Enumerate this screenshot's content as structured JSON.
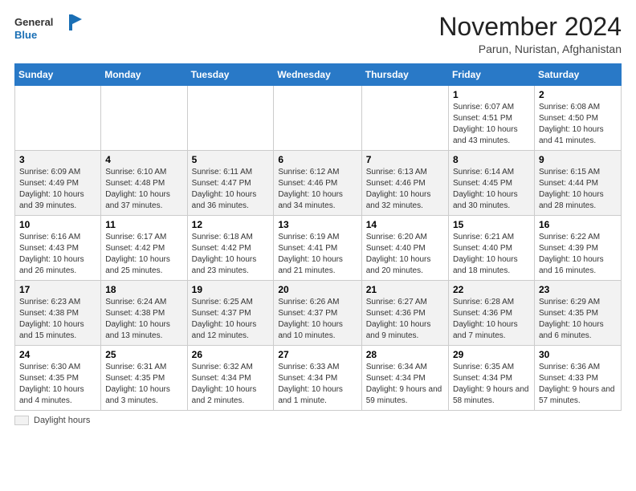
{
  "header": {
    "logo_line1": "General",
    "logo_line2": "Blue",
    "month_title": "November 2024",
    "location": "Parun, Nuristan, Afghanistan"
  },
  "days_of_week": [
    "Sunday",
    "Monday",
    "Tuesday",
    "Wednesday",
    "Thursday",
    "Friday",
    "Saturday"
  ],
  "footer": {
    "daylight_label": "Daylight hours"
  },
  "weeks": [
    [
      {
        "day": "",
        "sunrise": "",
        "sunset": "",
        "daylight": ""
      },
      {
        "day": "",
        "sunrise": "",
        "sunset": "",
        "daylight": ""
      },
      {
        "day": "",
        "sunrise": "",
        "sunset": "",
        "daylight": ""
      },
      {
        "day": "",
        "sunrise": "",
        "sunset": "",
        "daylight": ""
      },
      {
        "day": "",
        "sunrise": "",
        "sunset": "",
        "daylight": ""
      },
      {
        "day": "1",
        "sunrise": "6:07 AM",
        "sunset": "4:51 PM",
        "daylight": "10 hours and 43 minutes."
      },
      {
        "day": "2",
        "sunrise": "6:08 AM",
        "sunset": "4:50 PM",
        "daylight": "10 hours and 41 minutes."
      }
    ],
    [
      {
        "day": "3",
        "sunrise": "6:09 AM",
        "sunset": "4:49 PM",
        "daylight": "10 hours and 39 minutes."
      },
      {
        "day": "4",
        "sunrise": "6:10 AM",
        "sunset": "4:48 PM",
        "daylight": "10 hours and 37 minutes."
      },
      {
        "day": "5",
        "sunrise": "6:11 AM",
        "sunset": "4:47 PM",
        "daylight": "10 hours and 36 minutes."
      },
      {
        "day": "6",
        "sunrise": "6:12 AM",
        "sunset": "4:46 PM",
        "daylight": "10 hours and 34 minutes."
      },
      {
        "day": "7",
        "sunrise": "6:13 AM",
        "sunset": "4:46 PM",
        "daylight": "10 hours and 32 minutes."
      },
      {
        "day": "8",
        "sunrise": "6:14 AM",
        "sunset": "4:45 PM",
        "daylight": "10 hours and 30 minutes."
      },
      {
        "day": "9",
        "sunrise": "6:15 AM",
        "sunset": "4:44 PM",
        "daylight": "10 hours and 28 minutes."
      }
    ],
    [
      {
        "day": "10",
        "sunrise": "6:16 AM",
        "sunset": "4:43 PM",
        "daylight": "10 hours and 26 minutes."
      },
      {
        "day": "11",
        "sunrise": "6:17 AM",
        "sunset": "4:42 PM",
        "daylight": "10 hours and 25 minutes."
      },
      {
        "day": "12",
        "sunrise": "6:18 AM",
        "sunset": "4:42 PM",
        "daylight": "10 hours and 23 minutes."
      },
      {
        "day": "13",
        "sunrise": "6:19 AM",
        "sunset": "4:41 PM",
        "daylight": "10 hours and 21 minutes."
      },
      {
        "day": "14",
        "sunrise": "6:20 AM",
        "sunset": "4:40 PM",
        "daylight": "10 hours and 20 minutes."
      },
      {
        "day": "15",
        "sunrise": "6:21 AM",
        "sunset": "4:40 PM",
        "daylight": "10 hours and 18 minutes."
      },
      {
        "day": "16",
        "sunrise": "6:22 AM",
        "sunset": "4:39 PM",
        "daylight": "10 hours and 16 minutes."
      }
    ],
    [
      {
        "day": "17",
        "sunrise": "6:23 AM",
        "sunset": "4:38 PM",
        "daylight": "10 hours and 15 minutes."
      },
      {
        "day": "18",
        "sunrise": "6:24 AM",
        "sunset": "4:38 PM",
        "daylight": "10 hours and 13 minutes."
      },
      {
        "day": "19",
        "sunrise": "6:25 AM",
        "sunset": "4:37 PM",
        "daylight": "10 hours and 12 minutes."
      },
      {
        "day": "20",
        "sunrise": "6:26 AM",
        "sunset": "4:37 PM",
        "daylight": "10 hours and 10 minutes."
      },
      {
        "day": "21",
        "sunrise": "6:27 AM",
        "sunset": "4:36 PM",
        "daylight": "10 hours and 9 minutes."
      },
      {
        "day": "22",
        "sunrise": "6:28 AM",
        "sunset": "4:36 PM",
        "daylight": "10 hours and 7 minutes."
      },
      {
        "day": "23",
        "sunrise": "6:29 AM",
        "sunset": "4:35 PM",
        "daylight": "10 hours and 6 minutes."
      }
    ],
    [
      {
        "day": "24",
        "sunrise": "6:30 AM",
        "sunset": "4:35 PM",
        "daylight": "10 hours and 4 minutes."
      },
      {
        "day": "25",
        "sunrise": "6:31 AM",
        "sunset": "4:35 PM",
        "daylight": "10 hours and 3 minutes."
      },
      {
        "day": "26",
        "sunrise": "6:32 AM",
        "sunset": "4:34 PM",
        "daylight": "10 hours and 2 minutes."
      },
      {
        "day": "27",
        "sunrise": "6:33 AM",
        "sunset": "4:34 PM",
        "daylight": "10 hours and 1 minute."
      },
      {
        "day": "28",
        "sunrise": "6:34 AM",
        "sunset": "4:34 PM",
        "daylight": "9 hours and 59 minutes."
      },
      {
        "day": "29",
        "sunrise": "6:35 AM",
        "sunset": "4:34 PM",
        "daylight": "9 hours and 58 minutes."
      },
      {
        "day": "30",
        "sunrise": "6:36 AM",
        "sunset": "4:33 PM",
        "daylight": "9 hours and 57 minutes."
      }
    ]
  ]
}
